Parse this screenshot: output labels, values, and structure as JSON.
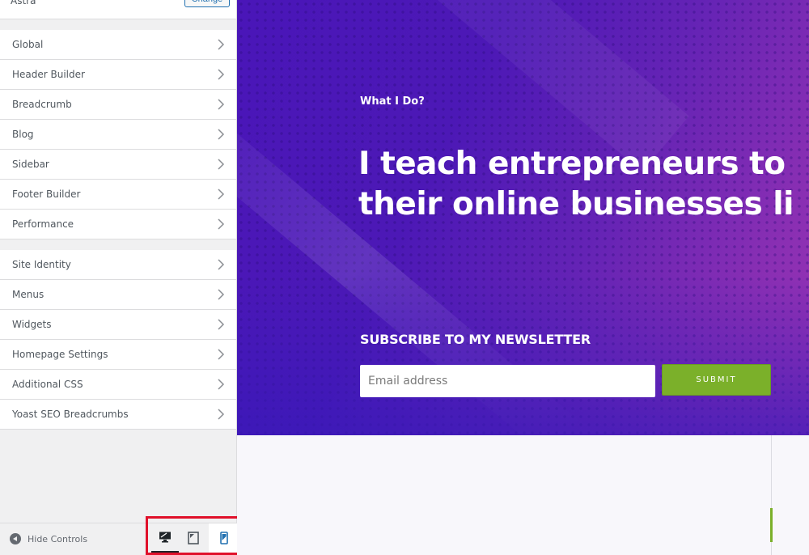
{
  "sidebar": {
    "theme": {
      "name": "Astra",
      "change_label": "Change"
    },
    "groups": [
      {
        "items": [
          {
            "label": "Global"
          },
          {
            "label": "Header Builder"
          },
          {
            "label": "Breadcrumb"
          },
          {
            "label": "Blog"
          },
          {
            "label": "Sidebar"
          },
          {
            "label": "Footer Builder"
          },
          {
            "label": "Performance"
          }
        ]
      },
      {
        "items": [
          {
            "label": "Site Identity"
          },
          {
            "label": "Menus"
          },
          {
            "label": "Widgets"
          },
          {
            "label": "Homepage Settings"
          },
          {
            "label": "Additional CSS"
          },
          {
            "label": "Yoast SEO Breadcrumbs"
          }
        ]
      }
    ],
    "footer": {
      "hide_controls_label": "Hide Controls",
      "devices": [
        {
          "name": "desktop",
          "active": true
        },
        {
          "name": "tablet",
          "active": false
        },
        {
          "name": "mobile",
          "active": false
        }
      ]
    }
  },
  "preview": {
    "eyebrow": "What I Do?",
    "headline_line1": "I teach entrepreneurs to",
    "headline_line2": "their online businesses li",
    "newsletter_title": "SUBSCRIBE TO MY NEWSLETTER",
    "email_placeholder": "Email address",
    "submit_label": "SUBMIT"
  },
  "colors": {
    "accent_green": "#7bb02a",
    "hero_purple": "#4a16b8",
    "highlight_red": "#e0102a"
  }
}
